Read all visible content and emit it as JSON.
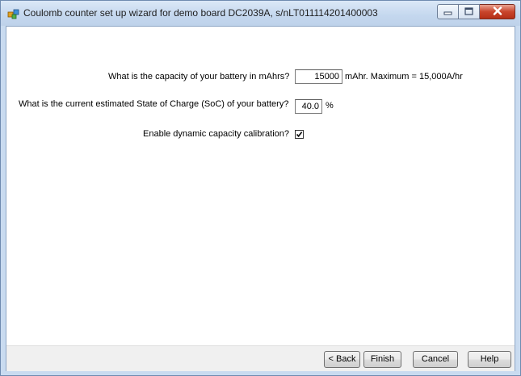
{
  "window": {
    "title": "Coulomb counter set up wizard for demo board DC2039A, s/nLT011114201400003"
  },
  "form": {
    "capacity_label": "What is the capacity of your battery in mAhrs?",
    "capacity_value": "15000",
    "capacity_units": "mAhr.  Maximum = 15,000A/hr",
    "soc_label": "What is the current estimated State of Charge (SoC) of your battery?",
    "soc_value": "40.0",
    "soc_units": "%",
    "calibration_label": "Enable dynamic capacity calibration?",
    "calibration_checked": true
  },
  "buttons": {
    "back": "< Back",
    "finish": "Finish",
    "cancel": "Cancel",
    "help": "Help"
  },
  "icons": {
    "app": "wizard-app-icon",
    "minimize": "minimize-icon",
    "maximize": "maximize-icon",
    "close": "close-icon",
    "check": "checkmark-icon"
  },
  "colors": {
    "titlebar": "#c4d7ee",
    "close_button": "#c9452c",
    "window_border": "#6f8bb0"
  }
}
